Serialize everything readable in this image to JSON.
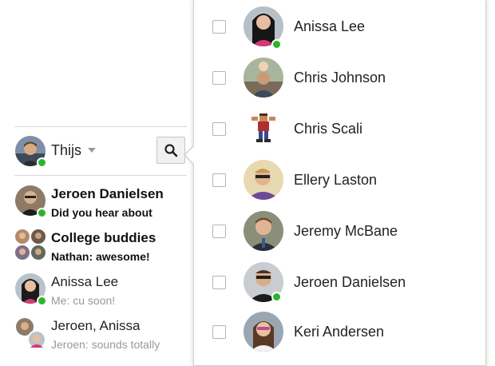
{
  "me": {
    "name": "Thijs",
    "status": "online"
  },
  "search": {
    "icon": "search-icon"
  },
  "conversations": [
    {
      "title": "Jeroen Danielsen",
      "snippet": "Did you hear about",
      "unread": true,
      "online": true
    },
    {
      "title": "College buddies",
      "snippet": "Nathan: awesome!",
      "unread": true,
      "group": true
    },
    {
      "title": "Anissa Lee",
      "snippet": "Me: cu soon!",
      "unread": false,
      "online": true
    },
    {
      "title": "Jeroen, Anissa",
      "snippet": "Jeroen: sounds totally",
      "unread": false,
      "group": true
    }
  ],
  "contacts": [
    {
      "name": "Anissa Lee",
      "online": true,
      "checked": false
    },
    {
      "name": "Chris Johnson",
      "online": false,
      "checked": false
    },
    {
      "name": "Chris Scali",
      "online": false,
      "checked": false
    },
    {
      "name": "Ellery Laston",
      "online": false,
      "checked": false
    },
    {
      "name": "Jeremy McBane",
      "online": false,
      "checked": false
    },
    {
      "name": "Jeroen Danielsen",
      "online": true,
      "checked": false
    },
    {
      "name": "Keri Andersen",
      "online": false,
      "checked": false
    }
  ],
  "colors": {
    "online": "#2bb52b",
    "divider": "#d9d9d9",
    "snippet_read": "#999999"
  }
}
